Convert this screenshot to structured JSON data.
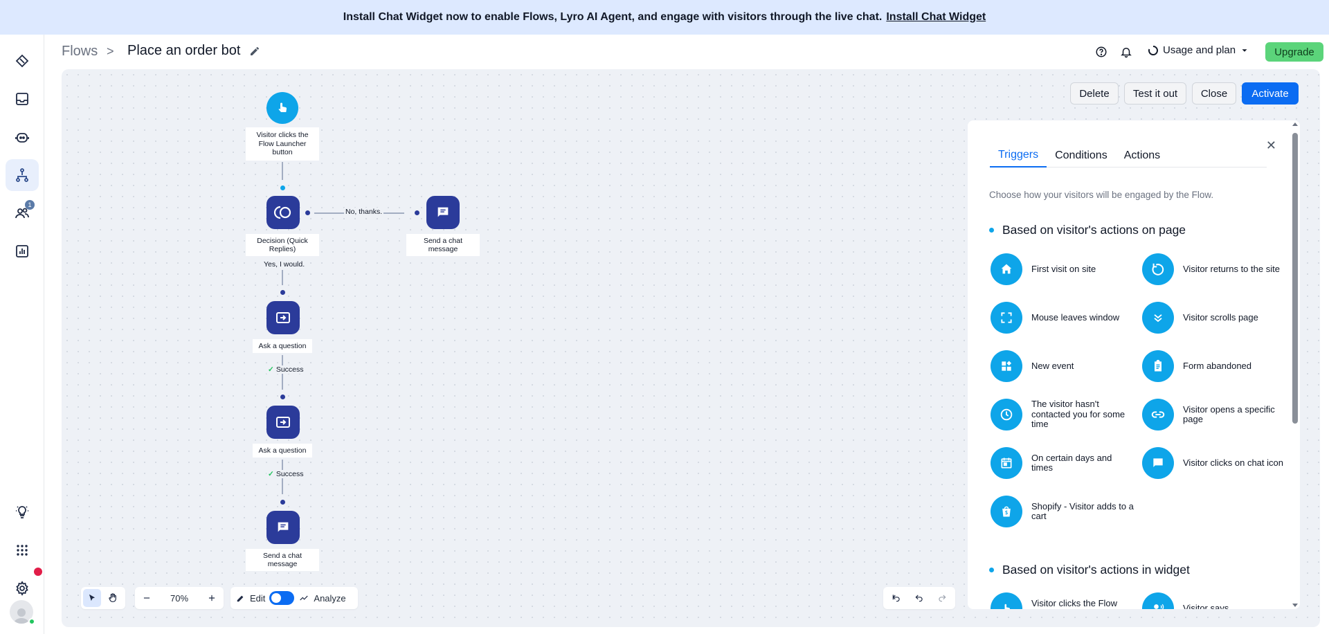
{
  "banner": {
    "text": "Install Chat Widget now to enable Flows, Lyro AI Agent, and engage with visitors through the live chat.",
    "link": "Install Chat Widget"
  },
  "sidebar": {
    "items": [
      {
        "name": "dashboard",
        "icon": "dashboard-icon"
      },
      {
        "name": "inbox",
        "icon": "inbox-icon"
      },
      {
        "name": "lyro-ai",
        "icon": "bot-icon"
      },
      {
        "name": "flows",
        "icon": "flows-icon",
        "active": true
      },
      {
        "name": "customers",
        "icon": "customers-icon",
        "badge": "1"
      },
      {
        "name": "analytics",
        "icon": "analytics-icon"
      },
      {
        "name": "discover",
        "icon": "lightbulb-icon"
      },
      {
        "name": "integrations",
        "icon": "apps-icon"
      },
      {
        "name": "settings",
        "icon": "gear-icon"
      }
    ]
  },
  "header": {
    "breadcrumb": "Flows",
    "separator": ">",
    "title": "Place an order bot",
    "usage_label": "Usage and plan",
    "upgrade_label": "Upgrade"
  },
  "actions": {
    "delete": "Delete",
    "test": "Test it out",
    "close": "Close",
    "activate": "Activate"
  },
  "flow": {
    "nodes": {
      "trigger": "Visitor clicks the Flow Launcher button",
      "decision": "Decision (Quick Replies)",
      "send1": "Send a chat message",
      "ask1": "Ask a question",
      "ask2": "Ask a question",
      "send2": "Send a chat message"
    },
    "edges": {
      "no": "No, thanks.",
      "yes": "Yes, I would.",
      "success1": "Success",
      "success2": "Success"
    }
  },
  "toolbar": {
    "zoom": "70%",
    "edit": "Edit",
    "analyze": "Analyze"
  },
  "panel": {
    "tabs": [
      "Triggers",
      "Conditions",
      "Actions"
    ],
    "active_tab": "Triggers",
    "description": "Choose how your visitors will be engaged by the Flow.",
    "section1": "Based on visitor's actions on page",
    "section2": "Based on visitor's actions in widget",
    "triggers": [
      {
        "label": "First visit on site",
        "icon": "home-icon"
      },
      {
        "label": "Visitor returns to the site",
        "icon": "refresh-icon"
      },
      {
        "label": "Mouse leaves window",
        "icon": "fullscreen-icon"
      },
      {
        "label": "Visitor scrolls page",
        "icon": "scroll-down-icon"
      },
      {
        "label": "New event",
        "icon": "widgets-icon"
      },
      {
        "label": "Form abandoned",
        "icon": "clipboard-icon"
      },
      {
        "label": "The visitor hasn't contacted you for some time",
        "icon": "clock-icon"
      },
      {
        "label": "Visitor opens a specific page",
        "icon": "link-icon"
      },
      {
        "label": "On certain days and times",
        "icon": "calendar-icon"
      },
      {
        "label": "Visitor clicks on chat icon",
        "icon": "chat-icon"
      },
      {
        "label": "Shopify - Visitor adds to a cart",
        "icon": "shopify-bag-icon"
      }
    ],
    "widget_triggers": [
      {
        "label": "Visitor clicks the Flow Launcher",
        "icon": "touch-icon"
      },
      {
        "label": "Visitor says",
        "icon": "voice-icon"
      }
    ]
  },
  "colors": {
    "accent": "#0b6cf2",
    "node": "#2b3b9a",
    "trigger": "#0ea5e9",
    "upgrade": "#5bd47a",
    "banner": "#dde9ff"
  }
}
